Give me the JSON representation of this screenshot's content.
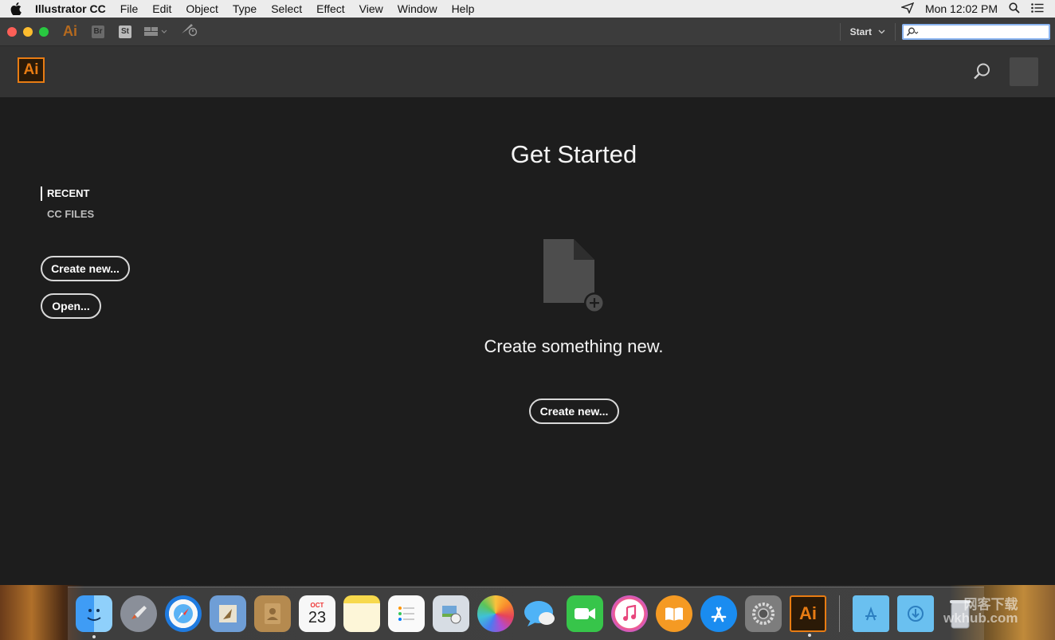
{
  "menubar": {
    "app_name": "Illustrator CC",
    "items": [
      "File",
      "Edit",
      "Object",
      "Type",
      "Select",
      "Effect",
      "View",
      "Window",
      "Help"
    ],
    "clock": "Mon 12:02 PM"
  },
  "toolbar": {
    "app_short": "Ai",
    "bridge_label": "Br",
    "stock_label": "St",
    "workspace_label": "Start",
    "search_placeholder": ""
  },
  "header": {
    "logo_text": "Ai"
  },
  "sidebar": {
    "recent_label": "RECENT",
    "cc_files_label": "CC FILES",
    "create_new_label": "Create new...",
    "open_label": "Open..."
  },
  "main": {
    "title": "Get Started",
    "subtitle": "Create something new.",
    "create_new_label": "Create new..."
  },
  "dock": {
    "calendar_month": "OCT",
    "calendar_day": "23",
    "illustrator_label": "Ai",
    "items": [
      "finder-icon",
      "launchpad-icon",
      "safari-icon",
      "mail-icon",
      "contacts-icon",
      "calendar-icon",
      "notes-icon",
      "reminders-icon",
      "preview-icon",
      "photos-icon",
      "messages-icon",
      "facetime-icon",
      "itunes-icon",
      "ibooks-icon",
      "app-store-icon",
      "system-preferences-icon",
      "illustrator-icon"
    ]
  },
  "watermark": {
    "line1": "网客下载",
    "line2": "wkhub.com"
  },
  "colors": {
    "accent": "#e87c13",
    "background": "#1d1d1d",
    "header": "#333333"
  }
}
